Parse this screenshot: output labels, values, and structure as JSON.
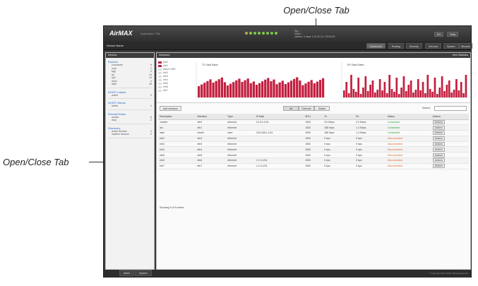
{
  "callouts": {
    "top": "Open/Close Tab",
    "left": "Open/Close Tab"
  },
  "app": {
    "logo": "AirMAX",
    "subtitle": "Application Title"
  },
  "header": {
    "signal": [
      "Sig: ..",
      "Noise: ..",
      "Uptime: 4 days 1:13:22:14 / 00:00:00"
    ],
    "btn_lang": "EN",
    "btn_tools": "Tools"
  },
  "nav": {
    "device": "Device Name",
    "tabs": [
      "Dashboard",
      "Routing",
      "Security",
      "Services",
      "System",
      "Wizards"
    ]
  },
  "sidebar": {
    "header": "Devices",
    "sections": [
      {
        "title": "Routers",
        "rows": [
          [
            "connected",
            "6"
          ],
          [
            "ospf",
            "2"
          ],
          [
            "bgp",
            "0"
          ],
          [
            "rip",
            "24"
          ],
          [
            "rip2",
            "14"
          ],
          [
            "dhcp",
            "4"
          ],
          [
            "wlan",
            "28"
          ]
        ]
      },
      {
        "title": "DHCP Leases",
        "rows": [
          [
            "active",
            "4"
          ]
        ]
      },
      {
        "title": "DHCP Clients",
        "rows": [
          [
            "active",
            "4"
          ]
        ]
      },
      {
        "title": "Firewall Rules",
        "rows": [
          [
            "accept",
            "5"
          ],
          [
            "drop",
            "2"
          ]
        ]
      },
      {
        "title": "Discovery",
        "rows": [
          [
            "active devices",
            "0"
          ],
          [
            "inactive devices",
            "0"
          ]
        ]
      }
    ]
  },
  "main": {
    "header_left": "Interfaces",
    "header_right": "View Statistics",
    "legend": [
      "eth0",
      "eth1",
      "wlan0 GRE",
      "eth2",
      "eth3",
      "eth4",
      "eth5",
      "eth6",
      "eth7"
    ],
    "chart1_title": "TX Data Rates",
    "chart2_title": "RX Data Rates",
    "toolbar": {
      "add": "Add Interface",
      "seg": [
        "All",
        "Ethernet",
        "Switch"
      ],
      "search_label": "Search:"
    },
    "columns": [
      "Description",
      "Interface",
      "Type",
      "IP Addr",
      "MTU",
      "Tx",
      "Rx",
      "Status",
      "Actions"
    ],
    "rows": [
      [
        "outside",
        "eth0",
        "ethernet",
        "10.0.0.1/24",
        "1500",
        "9.6 Mbps",
        "0.0 Mbps",
        "Connected",
        "Actions"
      ],
      [
        "lan",
        "eth1",
        "ethernet",
        "",
        "1500",
        "188 kbps",
        "1.4 Mbps",
        "Connected",
        "Actions"
      ],
      [
        "wlan",
        "wlan0",
        "wlan",
        "192.168.1.1/24",
        "1500",
        "188 kbps",
        "1.4 Mbps",
        "Connected",
        "Actions"
      ],
      [
        "eth2",
        "eth2",
        "ethernet",
        "",
        "1500",
        "0 bps",
        "0 bps",
        "Disconnected",
        "Actions"
      ],
      [
        "eth3",
        "eth3",
        "ethernet",
        "",
        "1500",
        "0 bps",
        "0 bps",
        "Disconnected",
        "Actions"
      ],
      [
        "eth4",
        "eth4",
        "ethernet",
        "",
        "1500",
        "0 bps",
        "0 bps",
        "Disconnected",
        "Actions"
      ],
      [
        "eth5",
        "eth5",
        "ethernet",
        "",
        "1500",
        "0 bps",
        "0 bps",
        "Disconnected",
        "Actions"
      ],
      [
        "eth6",
        "eth6",
        "ethernet",
        "1.2.3.1/24",
        "1500",
        "0 bps",
        "0 bps",
        "Disconnected",
        "Actions"
      ],
      [
        "eth7",
        "eth7",
        "ethernet",
        "1.2.4.1/24",
        "1500",
        "0 bps",
        "0 bps",
        "Disconnected",
        "Actions"
      ]
    ],
    "count": "Showing 9 of 9 entries"
  },
  "footer": {
    "tabs": [
      "Alerts",
      "System"
    ],
    "copy": "© Copyright 2012-2013 Ubiquiti Networks"
  }
}
